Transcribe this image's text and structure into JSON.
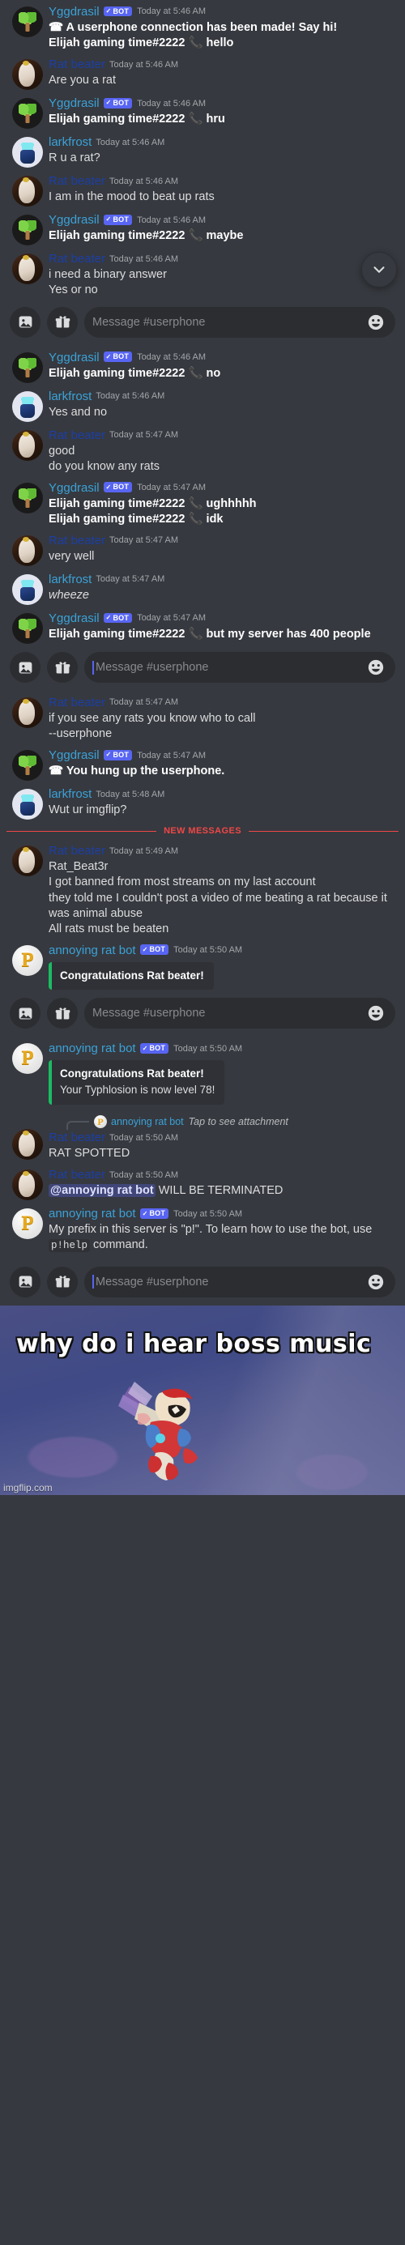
{
  "channel": {
    "name": "#userphone"
  },
  "composer": {
    "placeholder": "Message #userphone",
    "image_icon": "image-icon",
    "gift_icon": "gift-icon",
    "emoji_icon": "emoji-icon"
  },
  "new_messages_divider": {
    "label": "NEW MESSAGES"
  },
  "jump_button": {
    "icon": "chevron-down-icon"
  },
  "reply_preview": {
    "author": "annoying rat bot",
    "text": "Tap to see attachment"
  },
  "colors": {
    "background": "#36393f",
    "bot_tag": "#5865f2",
    "new_messages": "#f04747",
    "embed_accent": "#1abc62",
    "username_blue": "#3ba2d8",
    "username_dark_blue": "#1c3fa7"
  },
  "messages": [
    {
      "author": "Yggdrasil",
      "bot": true,
      "bot_label": "BOT",
      "timestamp": "Today at 5:46 AM",
      "avatar": "tree-avatar",
      "lines": [
        {
          "text": "☎ A userphone connection has been made! Say hi!",
          "bold": true
        },
        {
          "text": "Elijah gaming time#2222 📞 hello",
          "bold": false
        }
      ]
    },
    {
      "author": "Rat beater",
      "bot": false,
      "timestamp": "Today at 5:46 AM",
      "avatar": "rat-avatar",
      "lines": [
        {
          "text": "Are you a rat"
        }
      ]
    },
    {
      "author": "Yggdrasil",
      "bot": true,
      "bot_label": "BOT",
      "timestamp": "Today at 5:46 AM",
      "avatar": "tree-avatar",
      "lines": [
        {
          "text": "Elijah gaming time#2222 📞 hru",
          "bold": true
        }
      ]
    },
    {
      "author": "larkfrost",
      "bot": false,
      "timestamp": "Today at 5:46 AM",
      "avatar": "larkfrost-avatar",
      "lines": [
        {
          "text": "R u a rat?"
        }
      ]
    },
    {
      "author": "Rat beater",
      "bot": false,
      "timestamp": "Today at 5:46 AM",
      "avatar": "rat-avatar",
      "lines": [
        {
          "text": "I am in the mood to beat up rats"
        }
      ]
    },
    {
      "author": "Yggdrasil",
      "bot": true,
      "bot_label": "BOT",
      "timestamp": "Today at 5:46 AM",
      "avatar": "tree-avatar",
      "lines": [
        {
          "text": "Elijah gaming time#2222 📞 maybe",
          "bold": true
        }
      ]
    },
    {
      "author": "Rat beater",
      "bot": false,
      "timestamp": "Today at 5:46 AM",
      "avatar": "rat-avatar",
      "lines": [
        {
          "text": "i need a binary answer"
        },
        {
          "text": "Yes or no"
        }
      ]
    },
    {
      "author": "Yggdrasil",
      "bot": true,
      "bot_label": "BOT",
      "timestamp": "Today at 5:46 AM",
      "avatar": "tree-avatar",
      "lines": [
        {
          "text": "Elijah gaming time#2222 📞 no",
          "bold": true
        }
      ]
    },
    {
      "author": "larkfrost",
      "bot": false,
      "timestamp": "Today at 5:46 AM",
      "avatar": "larkfrost-avatar",
      "lines": [
        {
          "text": "Yes and no"
        }
      ]
    },
    {
      "author": "Rat beater",
      "bot": false,
      "timestamp": "Today at 5:47 AM",
      "avatar": "rat-avatar",
      "lines": [
        {
          "text": "good"
        },
        {
          "text": "do you know any rats"
        }
      ]
    },
    {
      "author": "Yggdrasil",
      "bot": true,
      "bot_label": "BOT",
      "timestamp": "Today at 5:47 AM",
      "avatar": "tree-avatar",
      "lines": [
        {
          "text": "Elijah gaming time#2222 📞 ughhhhh",
          "bold": true
        },
        {
          "text": "Elijah gaming time#2222 📞 idk",
          "bold": true
        }
      ]
    },
    {
      "author": "Rat beater",
      "bot": false,
      "timestamp": "Today at 5:47 AM",
      "avatar": "rat-avatar",
      "lines": [
        {
          "text": "very well"
        }
      ]
    },
    {
      "author": "larkfrost",
      "bot": false,
      "timestamp": "Today at 5:47 AM",
      "avatar": "larkfrost-avatar",
      "lines": [
        {
          "text": "wheeze",
          "italic": true
        }
      ]
    },
    {
      "author": "Yggdrasil",
      "bot": true,
      "bot_label": "BOT",
      "timestamp": "Today at 5:47 AM",
      "avatar": "tree-avatar",
      "lines": [
        {
          "text": "Elijah gaming time#2222 📞 but my server has 400 people",
          "bold": true
        }
      ]
    },
    {
      "author": "Rat beater",
      "bot": false,
      "timestamp": "Today at 5:47 AM",
      "avatar": "rat-avatar",
      "lines": [
        {
          "text": "if you see any rats you know who to call"
        },
        {
          "text": "--userphone"
        }
      ]
    },
    {
      "author": "Yggdrasil",
      "bot": true,
      "bot_label": "BOT",
      "timestamp": "Today at 5:47 AM",
      "avatar": "tree-avatar",
      "lines": [
        {
          "text": "☎ You hung up the userphone.",
          "bold": true
        }
      ]
    },
    {
      "author": "larkfrost",
      "bot": false,
      "timestamp": "Today at 5:48 AM",
      "avatar": "larkfrost-avatar",
      "lines": [
        {
          "text": "Wut ur imgflip?"
        }
      ]
    },
    {
      "author": "Rat beater",
      "bot": false,
      "timestamp": "Today at 5:49 AM",
      "avatar": "rat-avatar",
      "lines": [
        {
          "text": "Rat_Beat3r"
        },
        {
          "text": "I got banned from most streams on my last account"
        },
        {
          "text": "they told me I couldn't post a video of me beating a rat because it was animal abuse"
        },
        {
          "text": "All rats must be beaten"
        }
      ]
    },
    {
      "author": "annoying rat bot",
      "bot": true,
      "bot_label": "BOT",
      "timestamp": "Today at 5:50 AM",
      "avatar": "pbot-avatar",
      "embed": {
        "title": "Congratulations Rat beater!",
        "description": ""
      }
    },
    {
      "author": "annoying rat bot",
      "bot": true,
      "bot_label": "BOT",
      "timestamp": "Today at 5:50 AM",
      "avatar": "pbot-avatar",
      "embed": {
        "title": "Congratulations Rat beater!",
        "description": "Your Typhlosion is now level 78!"
      }
    },
    {
      "author": "Rat beater",
      "bot": false,
      "timestamp": "Today at 5:50 AM",
      "avatar": "rat-avatar",
      "lines": [
        {
          "text": "RAT SPOTTED"
        }
      ]
    },
    {
      "author": "Rat beater",
      "bot": false,
      "timestamp": "Today at 5:50 AM",
      "avatar": "rat-avatar",
      "mention": "@annoying rat bot",
      "mention_rest": " WILL BE TERMINATED"
    },
    {
      "author": "annoying rat bot",
      "bot": true,
      "bot_label": "BOT",
      "timestamp": "Today at 5:50 AM",
      "avatar": "pbot-avatar",
      "prefix_text_1": "My prefix in this server is \"p!\". To learn how to use the bot, use ",
      "prefix_code": "p!help",
      "prefix_text_2": " command."
    }
  ],
  "meme": {
    "caption": "why do i hear boss music",
    "watermark": "imgflip.com"
  }
}
